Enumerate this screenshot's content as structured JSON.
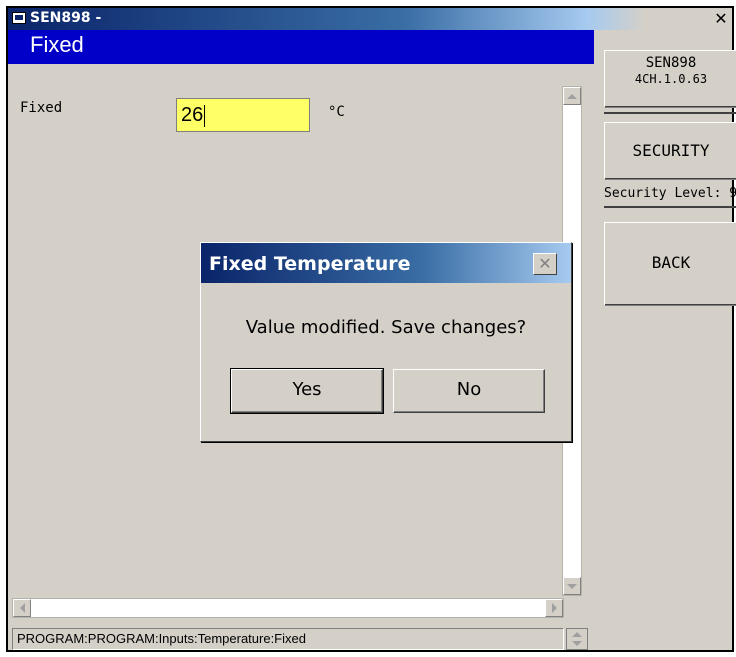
{
  "window": {
    "title": "SEN898 -",
    "close_symbol": "✕"
  },
  "header": {
    "title": "Fixed"
  },
  "form": {
    "label": "Fixed",
    "value": "26",
    "unit": "°C",
    "field_color": "#ffff66"
  },
  "right_panel": {
    "version_line1": "SEN898",
    "version_line2": "4CH.1.0.63",
    "security_button": "SECURITY",
    "security_level": "Security Level: 9",
    "back_button": "BACK"
  },
  "status_bar": {
    "text": "PROGRAM:PROGRAM:Inputs:Temperature:Fixed"
  },
  "dialog": {
    "title": "Fixed Temperature",
    "close_symbol": "✕",
    "message": "Value modified. Save changes?",
    "yes_label": "Yes",
    "no_label": "No"
  },
  "colors": {
    "header_bg": "#0000c8",
    "title_gradient_start": "#0a246a",
    "panel_bg": "#d4d0c8"
  }
}
